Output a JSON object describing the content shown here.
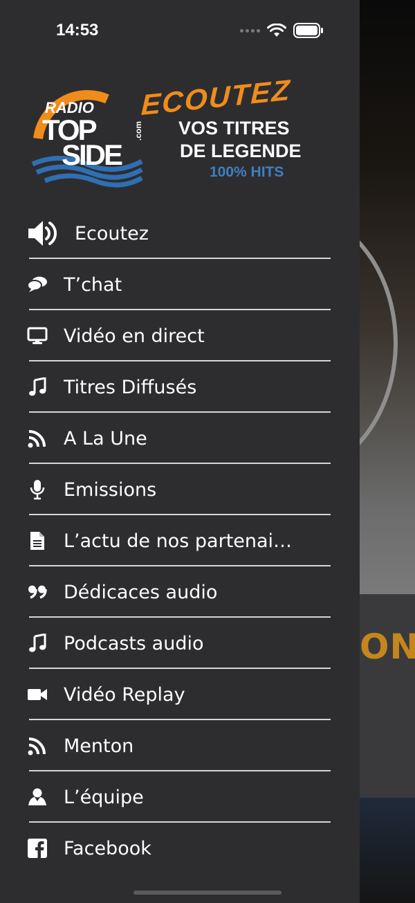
{
  "status_bar": {
    "time": "14:53"
  },
  "logo": {
    "radio": "RADIO",
    "top": "TOP",
    "side": "SIDE",
    "com": ".com",
    "ecoutez": "ECOUTEZ",
    "line1": "VOS TITRES",
    "line2": "DE LEGENDE",
    "hits": "100% HITS"
  },
  "menu": {
    "items": [
      {
        "label": "Ecoutez",
        "icon": "volume-icon"
      },
      {
        "label": "T’chat",
        "icon": "chat-icon"
      },
      {
        "label": "Vidéo en direct",
        "icon": "desktop-icon"
      },
      {
        "label": "Titres Diffusés",
        "icon": "music-note-icon"
      },
      {
        "label": "A La Une",
        "icon": "rss-icon"
      },
      {
        "label": "Emissions",
        "icon": "microphone-icon"
      },
      {
        "label": "L’actu de nos partenai…",
        "icon": "document-icon"
      },
      {
        "label": "Dédicaces audio",
        "icon": "quote-icon"
      },
      {
        "label": "Podcasts audio",
        "icon": "music-note-icon"
      },
      {
        "label": "Vidéo Replay",
        "icon": "video-camera-icon"
      },
      {
        "label": "Menton",
        "icon": "rss-icon"
      },
      {
        "label": "L’équipe",
        "icon": "user-icon"
      },
      {
        "label": "Facebook",
        "icon": "facebook-icon"
      }
    ]
  },
  "background": {
    "partial_text": "ON"
  },
  "colors": {
    "drawer": "#2d2d2f",
    "brand_orange": "#f08c1b",
    "brand_blue": "#3f7fc1",
    "divider": "#d6d6d6",
    "accent_text": "#c5861d"
  }
}
